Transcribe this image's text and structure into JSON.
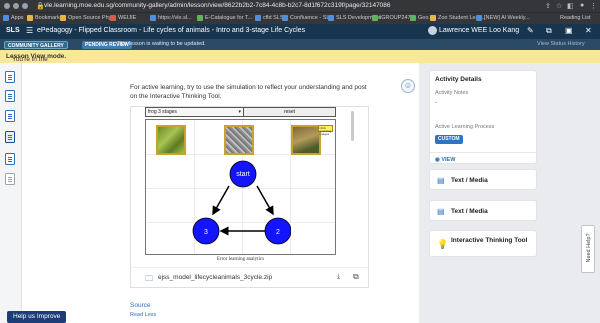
{
  "browser": {
    "url": "vle.learning.moe.edu.sg/community-gallery/admin/lesson/view/8622b2b2-7c84-4c8b-b2c7-8d1f672c319f/page/32147086",
    "bookmarks": [
      "Apps",
      "Bookmarks",
      "Open Source Phys",
      "WEIJIE",
      "https://vle.sl...",
      "E-Catalogue for T...",
      "cfld SLS",
      "Confluence - SLS",
      "SLS Development",
      "iGROUP2473",
      "Geo...",
      "Zoo Student Lear...",
      "[NEW] Al Weekly...",
      "Reading List"
    ]
  },
  "app": {
    "logo": "SLS",
    "title": "ePedagogy - Flipped Classroom - Life cycles of animals - Intro and 3-stage Life Cycles",
    "user": "Lawrence WEE Loo Kang"
  },
  "review": {
    "gallery_badge": "COMMUNITY GALLERY",
    "pending_badge": "PENDING REVIEW",
    "message": "This lesson is waiting to be updated.",
    "view_status": "View Status History"
  },
  "lesson_banner": {
    "prefix": "You're in the ",
    "mode": "Lesson View mode."
  },
  "main": {
    "instruction": "For active learning, try to use the simulation to reflect your understanding and post on the Interactive Thinking Tool.",
    "sim": {
      "select_value": "frog 3 stages",
      "reset_label": "reset",
      "tag_text": "Click and drag images",
      "nodes": [
        "start",
        "2",
        "3"
      ],
      "footer": "Error learning analytics"
    },
    "file_name": "ejss_model_lifecycleanimals_3cycle.zip",
    "source_label": "Source",
    "read_less": "Read Less",
    "help_button": "Help us Improve"
  },
  "right": {
    "activity_title": "Activity Details",
    "notes_label": "Activity Notes",
    "notes_value": "-",
    "process_label": "Active Learning Process",
    "process_badge": "CUSTOM",
    "view_link": "VIEW",
    "cards": [
      "Text / Media",
      "Text / Media"
    ],
    "itt_title": "Interactive Thinking Tool",
    "need_help": "Need Help?"
  },
  "colors": {
    "header": "#17354f",
    "review_bar": "#2b4a66",
    "lesson_banner": "#fbe79a",
    "accent": "#2d6fc0",
    "node_fill": "#1414ff"
  }
}
